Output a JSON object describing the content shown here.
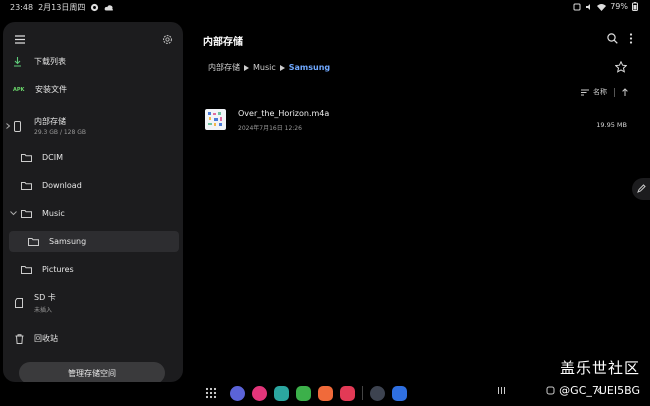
{
  "status": {
    "time": "23:48",
    "date": "2月13日周四",
    "battery": "79%"
  },
  "sidebar": {
    "downloads_label": "下载列表",
    "apk_badge": "APK",
    "install_label": "安装文件",
    "internal": {
      "label": "内部存储",
      "usage": "29.3 GB / 128 GB"
    },
    "folders": {
      "dcim": "DCIM",
      "download": "Download",
      "music": "Music",
      "samsung": "Samsung",
      "pictures": "Pictures"
    },
    "sd": {
      "label": "SD 卡",
      "status": "未插入"
    },
    "trash_label": "回收站",
    "manage_button": "管理存储空间"
  },
  "main": {
    "title": "内部存储",
    "breadcrumb": [
      "内部存储",
      "Music",
      "Samsung"
    ],
    "sort_label": "名称",
    "file": {
      "name": "Over_the_Horizon.m4a",
      "date": "2024年7月16日 12:26",
      "size": "19.95 MB"
    }
  },
  "watermark": {
    "line1": "盖乐世社区",
    "line2": "@GC_7UEI5BG"
  },
  "colors": {
    "accent": "#6fa8ff",
    "sidebar_bg": "#1c1c1e",
    "background": "#000000"
  }
}
